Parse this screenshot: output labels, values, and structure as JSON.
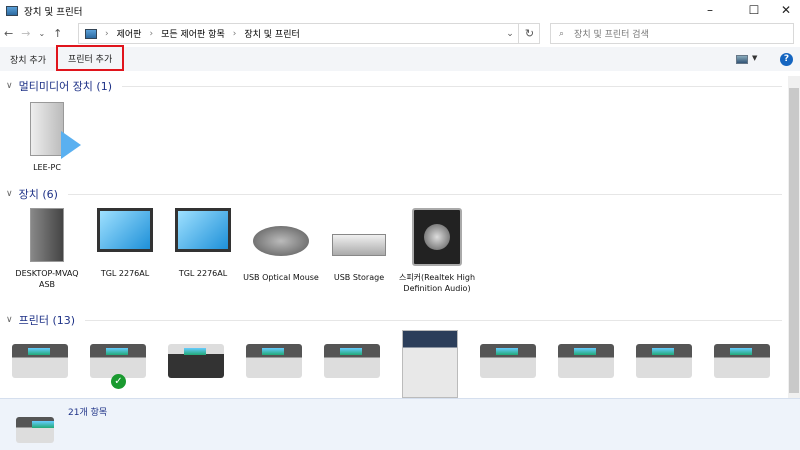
{
  "window": {
    "title": "장치 및 프린터"
  },
  "address": {
    "crumbs": [
      "제어판",
      "모든 제어판 항목",
      "장치 및 프린터"
    ]
  },
  "search": {
    "placeholder": "장치 및 프린터 검색"
  },
  "toolbar": {
    "add_device": "장치 추가",
    "add_printer": "프린터 추가",
    "help": "?"
  },
  "groups": {
    "multimedia": {
      "label": "멀티미디어 장치 (1)",
      "items": [
        "LEE-PC"
      ]
    },
    "devices": {
      "label": "장치 (6)",
      "items": [
        "DESKTOP-MVAQ ASB",
        "TGL 2276AL",
        "TGL 2276AL",
        "USB Optical Mouse",
        "USB Storage",
        "스피커(Realtek High Definition Audio)"
      ]
    },
    "printers": {
      "label": "프린터 (13)"
    }
  },
  "status": {
    "count": "21개 항목"
  }
}
